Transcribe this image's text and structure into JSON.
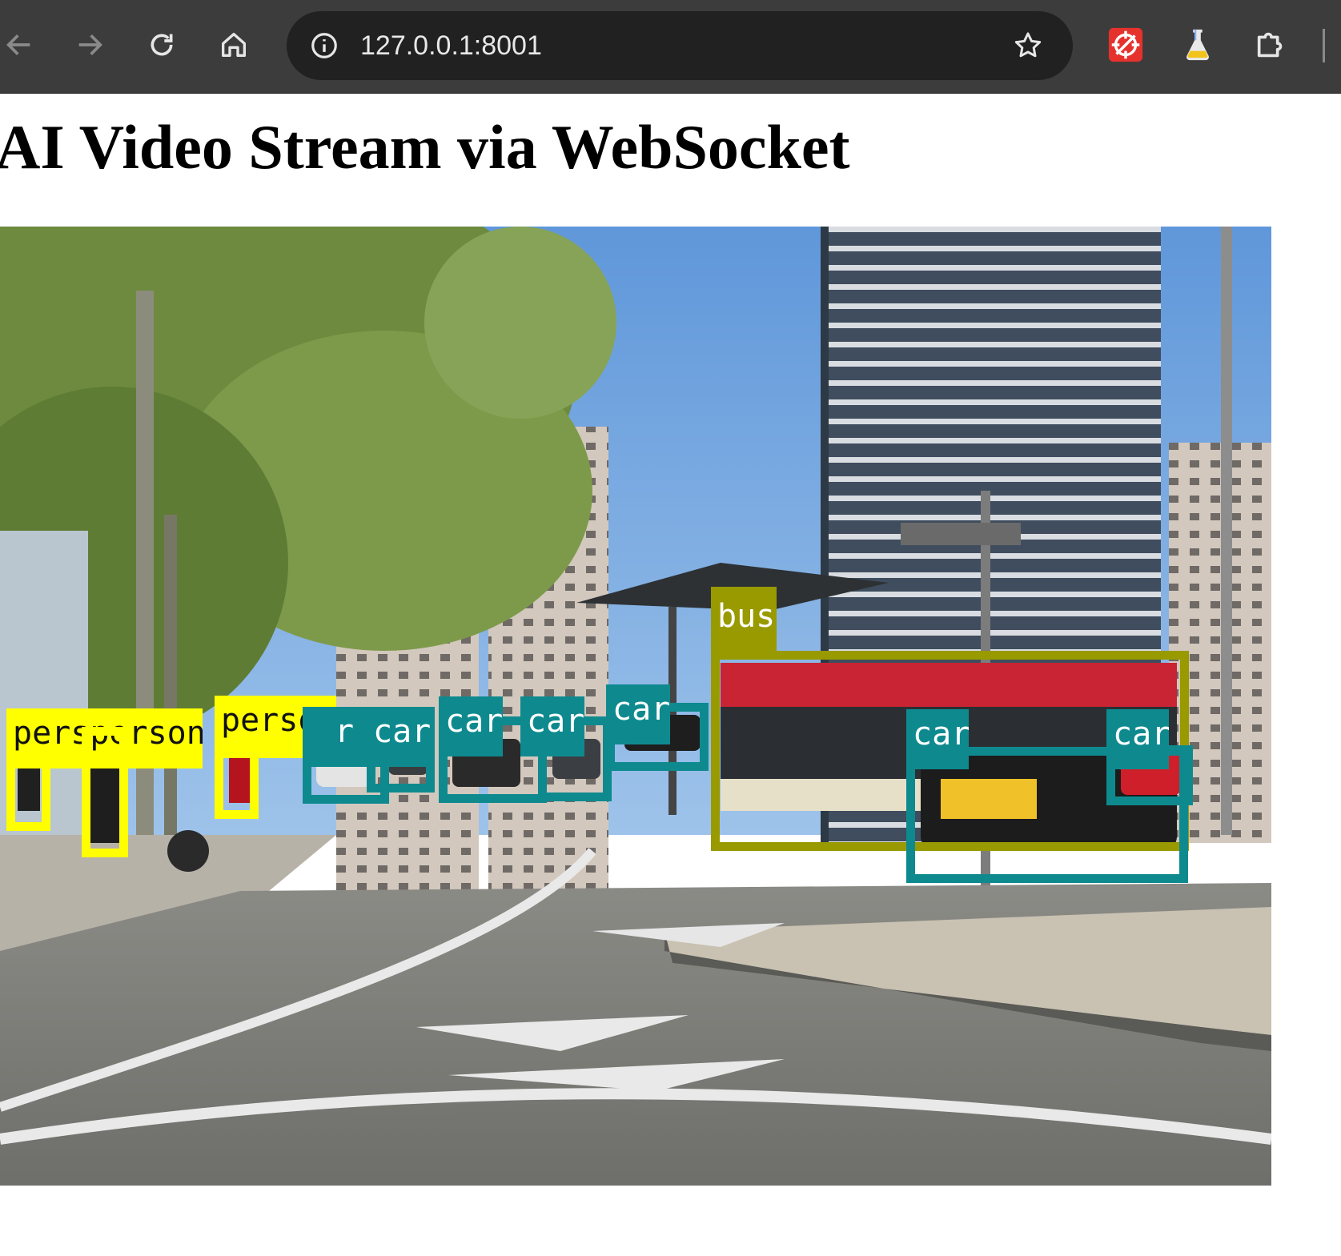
{
  "browser": {
    "url": "127.0.0.1:8001",
    "icons": {
      "back": "arrow-left-icon",
      "forward": "arrow-right-icon",
      "reload": "reload-icon",
      "home": "home-icon",
      "site_info": "info-circle-icon",
      "bookmark": "star-icon",
      "extension_1": "red-crosshair-extension-icon",
      "extension_2": "flask-extension-icon",
      "extensions": "puzzle-piece-icon"
    },
    "colors": {
      "toolbar": "#3c3c3c",
      "omnibox": "#212121",
      "url_text": "#e8e8e8"
    }
  },
  "page": {
    "title": "AI Video Stream via WebSocket"
  },
  "detections": {
    "colors": {
      "car": "#0e8a8f",
      "person": "#ffff00",
      "bus": "#999900"
    },
    "labels": {
      "person_1": "persperson",
      "person_3": "person",
      "car_1": "r",
      "car_2": "car",
      "car_3": "car",
      "car_4": "car",
      "car_5": "car",
      "bus": "bus",
      "car_6": "car",
      "car_7": "car"
    }
  }
}
